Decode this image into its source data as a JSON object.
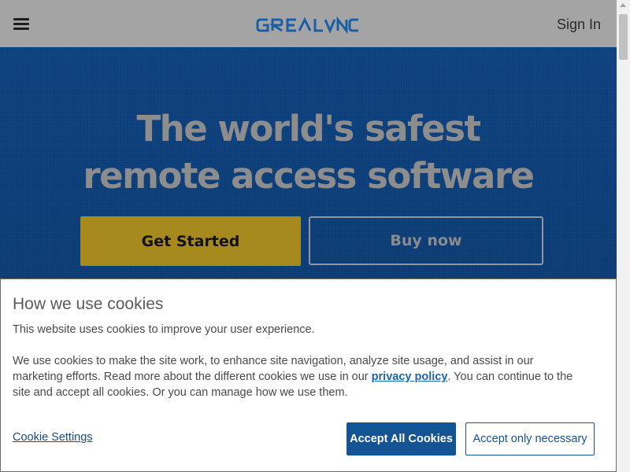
{
  "header": {
    "logo_text": "REALVNC",
    "sign_in_label": "Sign In",
    "menu_icon": "hamburger-icon"
  },
  "hero": {
    "title_line1": "The world's safest",
    "title_line2": "remote access software",
    "get_started_label": "Get Started",
    "buy_now_label": "Buy now"
  },
  "cookie_banner": {
    "title": "How we use cookies",
    "intro": "This website uses cookies to improve your user experience.",
    "body_before_link": "We use cookies to make the site work, to enhance site navigation, analyze site usage, and assist in our marketing efforts. Read more about the different cookies we use in our ",
    "privacy_link": "privacy policy",
    "body_after_link": ". You can continue to the site and accept all cookies. Or you can manage how we use them.",
    "settings_label": "Cookie Settings",
    "accept_all_label": "Accept All Cookies",
    "accept_necessary_label": "Accept only necessary"
  },
  "colors": {
    "header_bg": "#a4a4a4",
    "hero_bg": "#0c3e7a",
    "brand_blue": "#145394",
    "get_started_bg": "#a68a1e"
  }
}
